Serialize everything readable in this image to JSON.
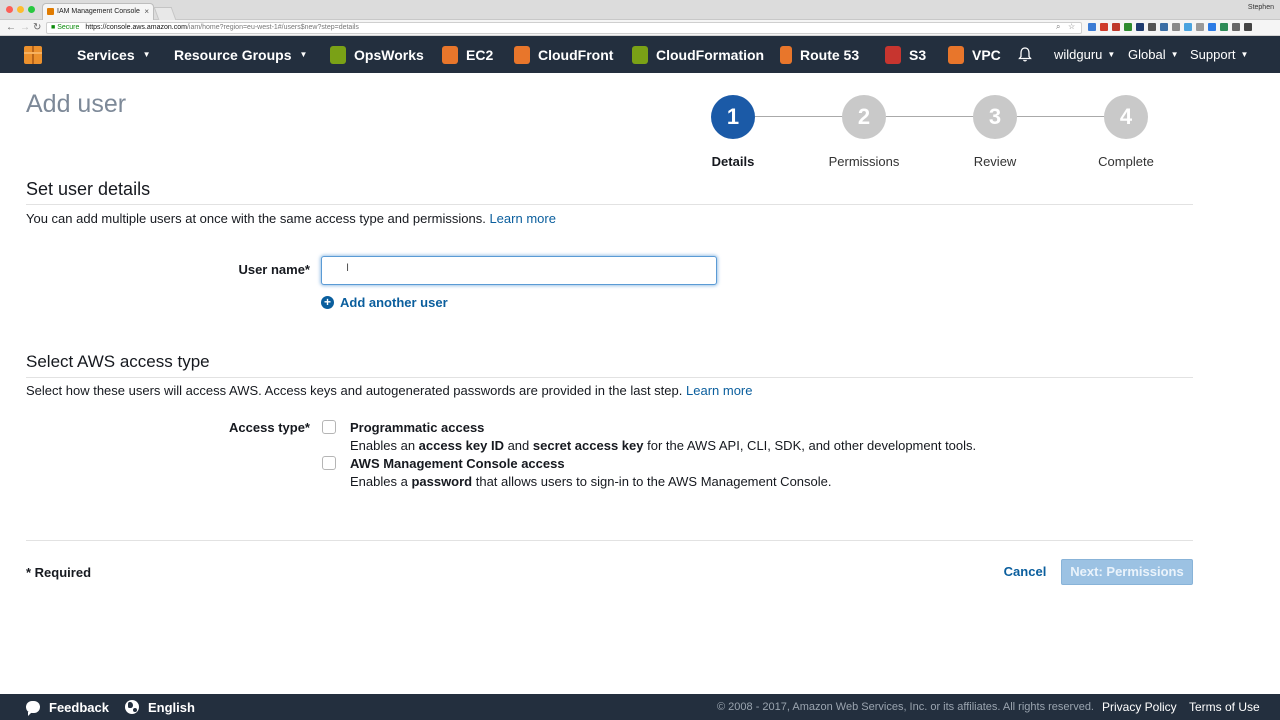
{
  "browser": {
    "tab_title": "IAM Management Console",
    "tab_close": "×",
    "profile_name": "Stephen",
    "secure_label": "Secure",
    "url_host": "https://console.aws.amazon.com",
    "url_path": "/iam/home?region=eu-west-1#/users$new?step=details"
  },
  "navbar": {
    "services": "Services",
    "resource_groups": "Resource Groups",
    "shortcuts": [
      {
        "label": "OpsWorks",
        "icon": "opsworks-icon",
        "color": "#7aa116"
      },
      {
        "label": "EC2",
        "icon": "ec2-icon",
        "color": "#e8762b"
      },
      {
        "label": "CloudFront",
        "icon": "cloudfront-icon",
        "color": "#e8762b"
      },
      {
        "label": "CloudFormation",
        "icon": "cloudformation-icon",
        "color": "#7aa116"
      },
      {
        "label": "Route 53",
        "icon": "route53-icon",
        "color": "#e8762b"
      },
      {
        "label": "S3",
        "icon": "s3-icon",
        "color": "#c7352f"
      },
      {
        "label": "VPC",
        "icon": "vpc-icon",
        "color": "#e8762b"
      }
    ],
    "account": "wildguru",
    "region": "Global",
    "support": "Support"
  },
  "page": {
    "title": "Add user",
    "steps": [
      {
        "number": "1",
        "label": "Details",
        "active": true
      },
      {
        "number": "2",
        "label": "Permissions",
        "active": false
      },
      {
        "number": "3",
        "label": "Review",
        "active": false
      },
      {
        "number": "4",
        "label": "Complete",
        "active": false
      }
    ]
  },
  "user_details": {
    "heading": "Set user details",
    "description": "You can add multiple users at once with the same access type and permissions.",
    "learn_more": "Learn more",
    "user_name_label": "User name*",
    "user_name_value": "",
    "add_another_user": "Add another user"
  },
  "access_type": {
    "heading": "Select AWS access type",
    "description": "Select how these users will access AWS. Access keys and autogenerated passwords are provided in the last step.",
    "learn_more": "Learn more",
    "label": "Access type*",
    "options": [
      {
        "title": "Programmatic access",
        "desc_parts": [
          "Enables an ",
          "access key ID",
          " and ",
          "secret access key",
          " for the AWS API, CLI, SDK, and other development tools."
        ],
        "checked": false
      },
      {
        "title": "AWS Management Console access",
        "desc_parts": [
          "Enables a ",
          "password",
          " that allows users to sign-in to the AWS Management Console."
        ],
        "checked": false
      }
    ]
  },
  "form_footer": {
    "required_note": "* Required",
    "cancel": "Cancel",
    "next": "Next: Permissions"
  },
  "footer": {
    "feedback": "Feedback",
    "language": "English",
    "copyright": "© 2008 - 2017, Amazon Web Services, Inc. or its affiliates. All rights reserved.",
    "privacy": "Privacy Policy",
    "terms": "Terms of Use"
  },
  "colors": {
    "nav_bg": "#232f3e",
    "active_step": "#1b5aa7",
    "link": "#0a5e9d",
    "primary_button_disabled": "#9cc2e3"
  }
}
